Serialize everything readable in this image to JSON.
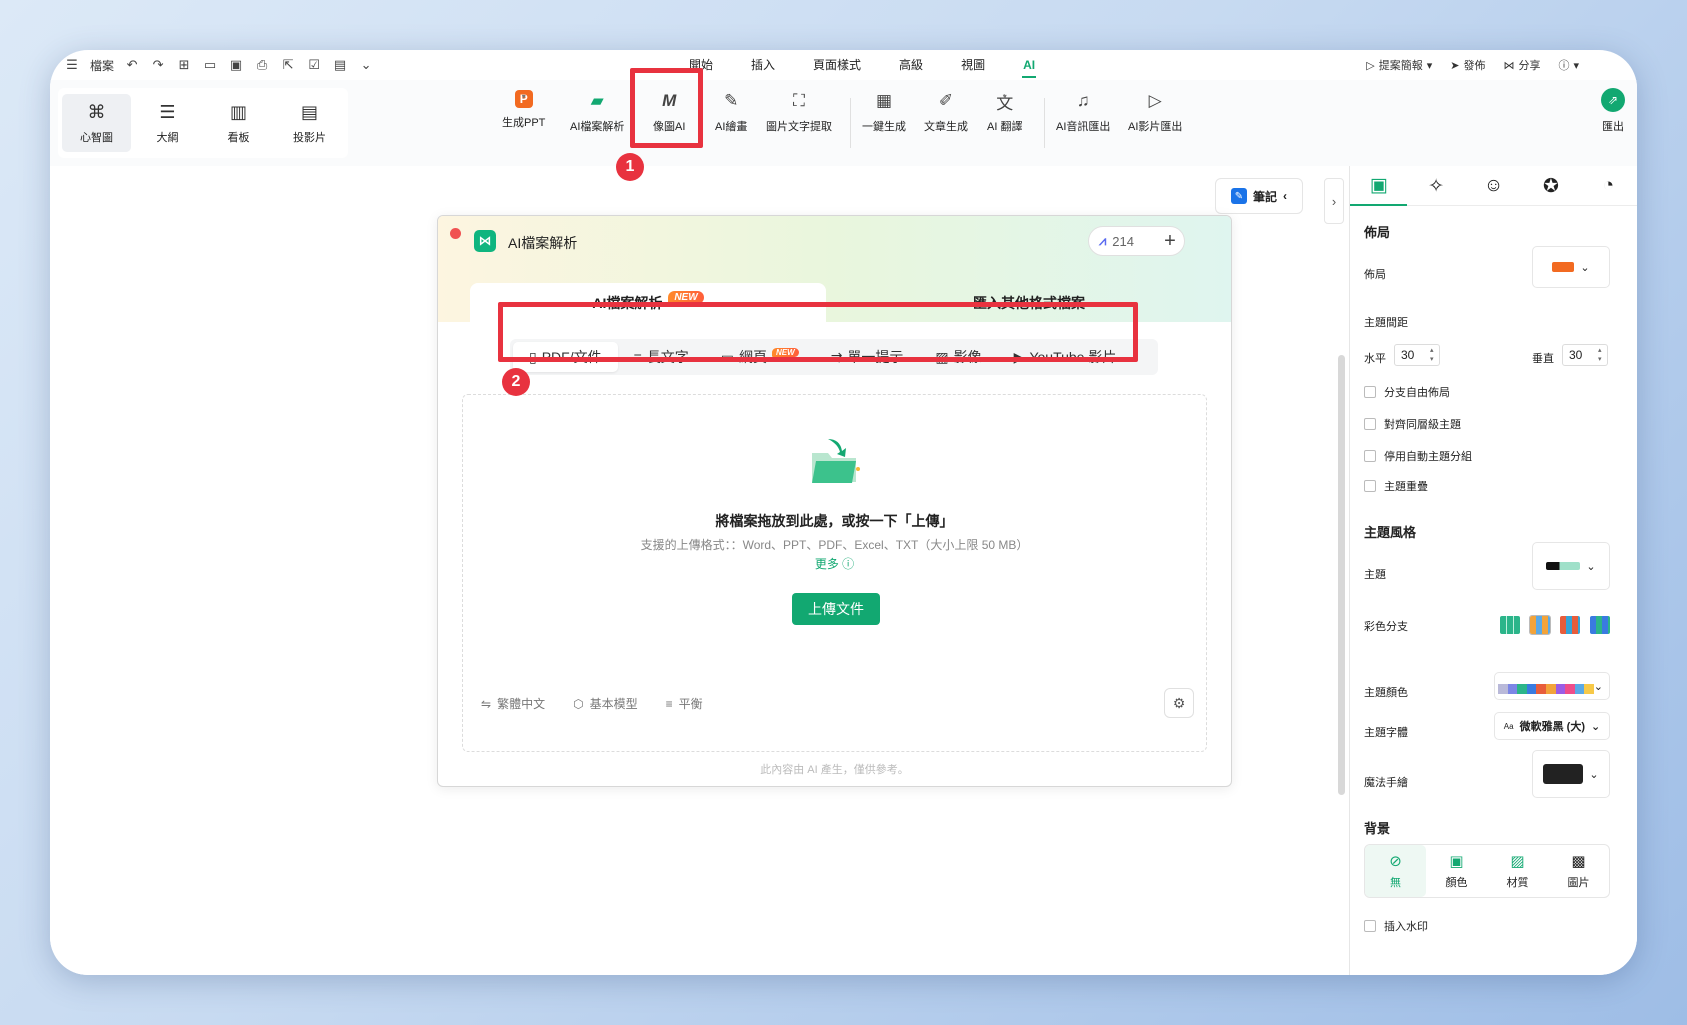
{
  "menubar": {
    "file_label": "檔案",
    "tabs": [
      "開始",
      "插入",
      "頁面樣式",
      "高級",
      "視圖",
      "AI"
    ],
    "active_tab": "AI",
    "right": {
      "presentation": "提案簡報",
      "publish": "發佈",
      "share": "分享"
    }
  },
  "views": [
    "心智圖",
    "大綱",
    "看板",
    "投影片"
  ],
  "ai_tools": {
    "gen_ppt": "生成PPT",
    "file_parse": "AI檔案解析",
    "image_ai": "像圖AI",
    "ai_draw": "AI繪畫",
    "ocr": "圖片文字提取",
    "one_click": "一鍵生成",
    "article": "文章生成",
    "translate": "AI 翻譯",
    "audio_export": "AI音訊匯出",
    "video_export": "AI影片匯出",
    "export": "匯出"
  },
  "callouts": [
    "1",
    "2"
  ],
  "notes_button": "筆記",
  "dialog": {
    "title": "AI檔案解析",
    "credits": "214",
    "tab_parse": "AI檔案解析",
    "new_badge": "NEW",
    "tab_import": "匯入其他格式檔案",
    "sources": [
      "PDF/文件",
      "長文字",
      "網頁",
      "單一提示",
      "影像",
      "YouTube 影片"
    ],
    "selected_source": "PDF/文件",
    "drop_title": "將檔案拖放到此處，或按一下「上傳」",
    "drop_formats": "支援的上傳格式：：Word、PPT、PDF、Excel、TXT（大小上限 50 MB）",
    "more": "更多",
    "upload_button": "上傳文件",
    "option_lang": "繁體中文",
    "option_model": "基本模型",
    "option_mode": "平衡",
    "disclaimer": "此內容由 AI 產生，僅供參考。"
  },
  "panel": {
    "layout_header": "佈局",
    "layout_label": "佈局",
    "spacing_header": "主題間距",
    "horizontal_label": "水平",
    "horizontal_value": "30",
    "vertical_label": "垂直",
    "vertical_value": "30",
    "checks": [
      "分支自由佈局",
      "對齊同層級主題",
      "停用自動主題分組",
      "主題重疊"
    ],
    "style_header": "主題風格",
    "theme_label": "主題",
    "rainbow_label": "彩色分支",
    "theme_color_label": "主題顏色",
    "theme_font_label": "主題字體",
    "theme_font_value": "微軟雅黑 (大)",
    "magic_label": "魔法手繪",
    "background_header": "背景",
    "bg_options": [
      "無",
      "顏色",
      "材質",
      "圖片"
    ],
    "watermark_label": "插入水印"
  },
  "colors": {
    "brand": "#12a871",
    "highlight": "#e8323f"
  }
}
